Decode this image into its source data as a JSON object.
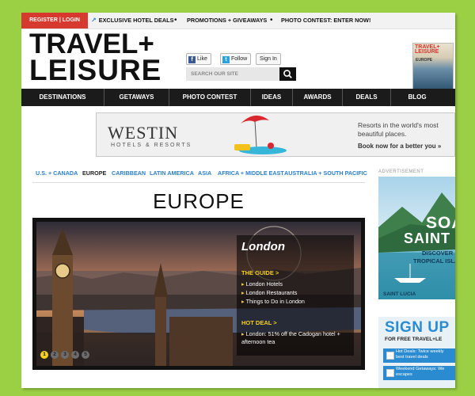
{
  "topbar": {
    "register_login": "REGISTER | LOGIN",
    "links": [
      "EXCLUSIVE HOTEL DEALS",
      "PROMOTIONS + GIVEAWAYS",
      "PHOTO CONTEST: ENTER NOW!"
    ]
  },
  "logo": {
    "line1": "TRAVEL+",
    "line2": "LEISURE"
  },
  "social": {
    "like": "Like",
    "follow": "Follow",
    "sign_in": "Sign In"
  },
  "search": {
    "placeholder": "SEARCH OUR SITE"
  },
  "magazine": {
    "title_line1": "TRAVEL+",
    "title_line2": "LEISURE",
    "subtitle": "EUROPE"
  },
  "nav": {
    "items": [
      "DESTINATIONS",
      "GETAWAYS",
      "PHOTO CONTEST",
      "IDEAS",
      "AWARDS",
      "DEALS",
      "BLOG"
    ]
  },
  "ad_banner": {
    "brand": "WESTIN",
    "brand_sub": "HOTELS & RESORTS",
    "tagline": "Resorts in the world's most beautiful places.",
    "cta": "Book now for a better you »"
  },
  "regions": {
    "items": [
      "U.S. + CANADA",
      "EUROPE",
      "CARIBBEAN",
      "LATIN AMERICA",
      "ASIA",
      "AFRICA + MIDDLE EAST",
      "AUSTRALIA + SOUTH PACIFIC"
    ],
    "active": "EUROPE",
    "link_color": "#2a7fd0"
  },
  "page_title": "EUROPE",
  "slideshow": {
    "city": "London",
    "guide_heading": "THE GUIDE >",
    "guide_items": [
      "London Hotels",
      "London Restaurants",
      "Things to Do in London"
    ],
    "deal_heading": "HOT DEAL >",
    "deal_text": "London: 51% off the Cadogan hotel + afternoon tea",
    "pager": [
      "1",
      "2",
      "3",
      "4",
      "5"
    ],
    "active_page": 1
  },
  "sidebar": {
    "ad_label": "ADVERTISEMENT",
    "ad": {
      "line1": "SOA",
      "line2": "SAINT",
      "line3": "DISCOVER",
      "line4": "TROPICAL ISLA",
      "brand": "SAINT LUCIA"
    },
    "signup": {
      "title": "SIGN UP",
      "subtitle": "FOR FREE TRAVEL+LE",
      "options": [
        {
          "line1": "Hot Deals: Twice weekly",
          "line2": "best travel deals"
        },
        {
          "line1": "Weekend Getaways: We",
          "line2": "escapes"
        }
      ]
    }
  },
  "colors": {
    "accent_red": "#d63a2f",
    "nav_bg": "#1b1b1b",
    "link_blue": "#2a7fd0",
    "highlight_yellow": "#f6d21b",
    "page_bg": "#9bcf44"
  }
}
